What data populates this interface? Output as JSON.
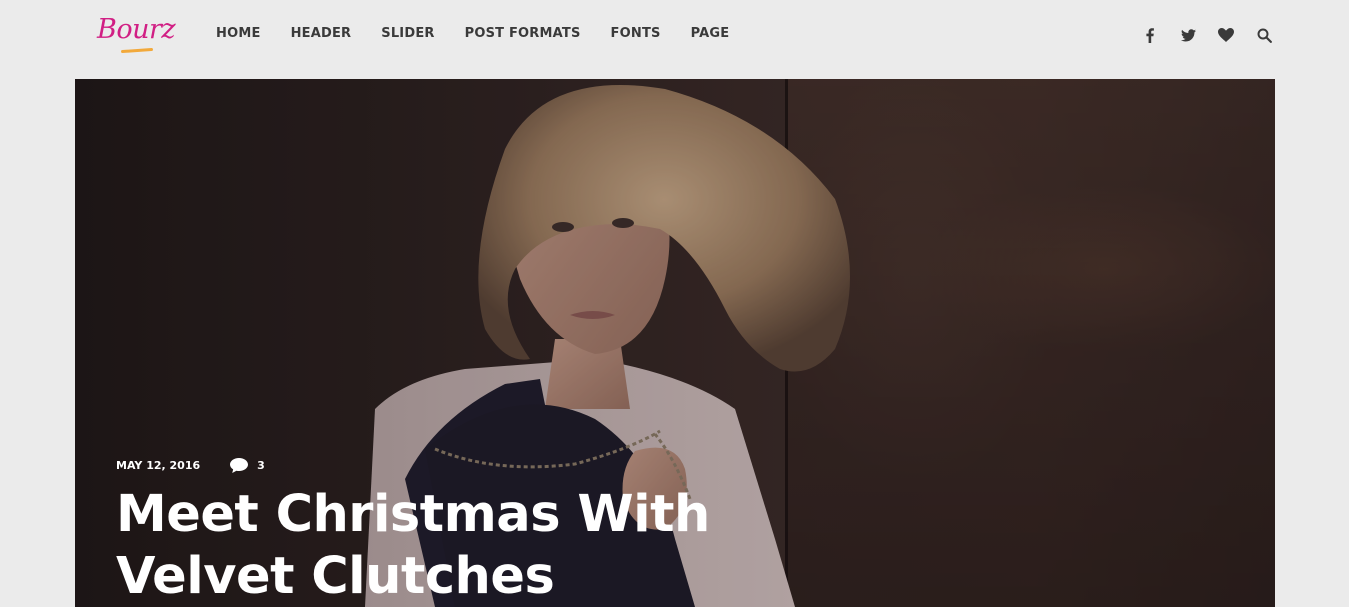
{
  "brand": {
    "logo_text": "Bourz",
    "accent": "#d11f84",
    "underline_color": "#f2a93b"
  },
  "nav": {
    "items": [
      {
        "label": "HOME"
      },
      {
        "label": "HEADER"
      },
      {
        "label": "SLIDER"
      },
      {
        "label": "POST FORMATS"
      },
      {
        "label": "FONTS"
      },
      {
        "label": "PAGE"
      }
    ]
  },
  "social": {
    "icons": [
      "facebook-icon",
      "twitter-icon",
      "heart-icon",
      "search-icon"
    ]
  },
  "hero": {
    "date": "MAY 12, 2016",
    "comment_count": "3",
    "title_line1": "Meet Christmas With",
    "title_line2": "Velvet Clutches"
  }
}
